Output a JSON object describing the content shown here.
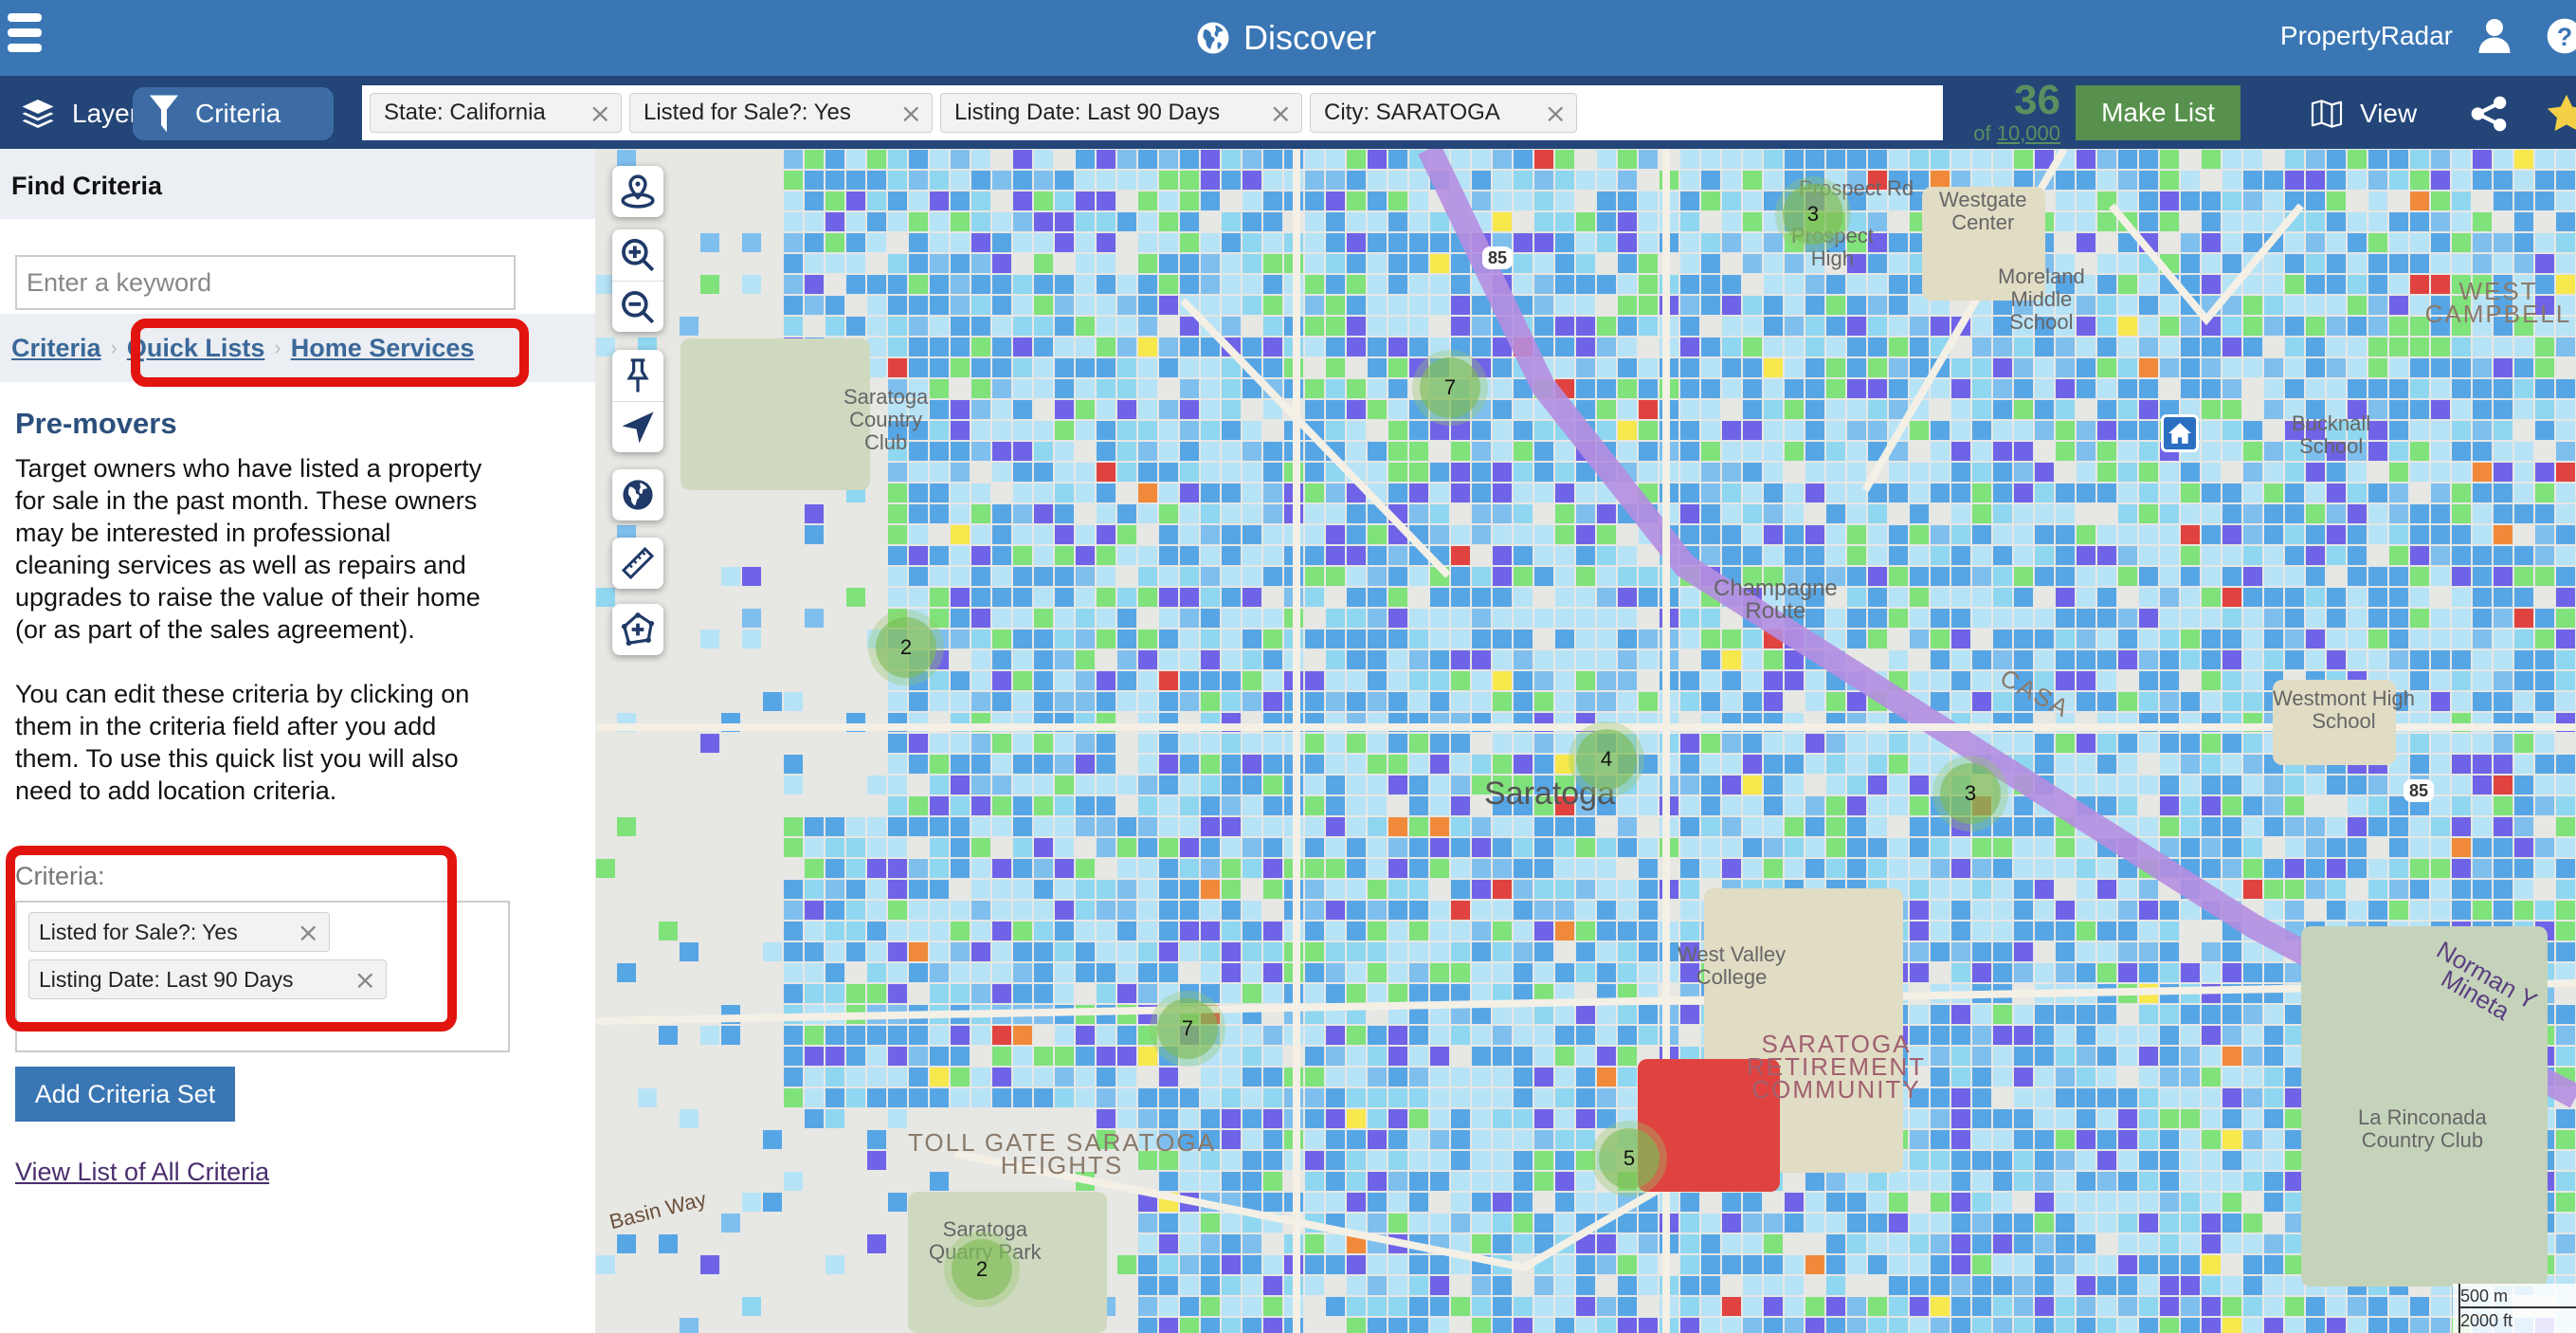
{
  "header": {
    "title": "Discover",
    "brand": "PropertyRadar",
    "icons": {
      "menu": "hamburger-icon",
      "title": "globe-icon",
      "user": "user-icon",
      "help": "help-icon"
    }
  },
  "toolbar": {
    "tabs": [
      {
        "label": "Layers",
        "icon": "layers-icon",
        "active": false
      },
      {
        "label": "Criteria",
        "icon": "filter-icon",
        "active": true
      }
    ],
    "filter_chips": [
      {
        "label": "State: California"
      },
      {
        "label": "Listed for Sale?: Yes"
      },
      {
        "label": "Listing Date: Last 90 Days"
      },
      {
        "label": "City: SARATOGA"
      }
    ],
    "chip_remove_glyph": "×",
    "result_count": "36",
    "result_of_prefix": "of ",
    "result_limit": "10,000",
    "make_list_label": "Make List",
    "view_label": "View",
    "share_icon": "share-icon",
    "star_icon": "star-icon",
    "colors": {
      "topbar": "#3a76b4",
      "toolbar": "#234578",
      "make_list": "#57914d",
      "count": "#5b8f5f"
    }
  },
  "sidebar": {
    "heading": "Find Criteria",
    "keyword_placeholder": "Enter a keyword",
    "keyword_value": "",
    "breadcrumb": [
      {
        "label": "Criteria"
      },
      {
        "label": "Quick Lists"
      },
      {
        "label": "Home Services"
      }
    ],
    "breadcrumb_separator": "›",
    "quick_list_title": "Pre-movers",
    "description_paragraphs": [
      "Target owners who have listed a property for sale in the past month. These owners may be interested in professional cleaning services as well as repairs and upgrades to raise the value of their home (or as part of the sales agreement).",
      "You can edit these criteria by clicking on them in the criteria field after you add them. To use this quick list you will also need to add location criteria."
    ],
    "criteria_label": "Criteria:",
    "criteria_chips": [
      {
        "label": "Listed for Sale?: Yes"
      },
      {
        "label": "Listing Date: Last 90 Days"
      }
    ],
    "add_set_label": "Add Criteria Set",
    "view_all_link": "View List of All Criteria",
    "annotation_color": "#e2140f"
  },
  "map": {
    "controls": [
      {
        "name": "locate-pin-icon",
        "title": "Location"
      },
      {
        "name": "zoom-in-icon",
        "title": "Zoom in"
      },
      {
        "name": "zoom-out-icon",
        "title": "Zoom out"
      },
      {
        "name": "pushpin-icon",
        "title": "Pin"
      },
      {
        "name": "navigate-arrow-icon",
        "title": "Navigate"
      },
      {
        "name": "globe-icon",
        "title": "Map type"
      },
      {
        "name": "ruler-icon",
        "title": "Measure"
      },
      {
        "name": "draw-shape-icon",
        "title": "Draw area"
      }
    ],
    "clusters": [
      "3",
      "7",
      "2",
      "4",
      "3",
      "7",
      "5",
      "2"
    ],
    "labels": {
      "saratoga_cc": "Saratoga\nCountry\nClub",
      "city": "Saratoga",
      "west_valley": "West Valley\nCollege",
      "westmont": "Westmont High\nSchool",
      "westgate": "Westgate\nCenter",
      "moreland": "Moreland\nMiddle\nSchool",
      "prospect_high": "Prospect\nHigh",
      "prospect_rd": "Prospect Rd",
      "champagne": "Champagne\nRoute",
      "casa": "CASA",
      "norman": "Norman Y Mineta",
      "quarry": "Saratoga\nQuarry Park",
      "toll_gate": "TOLL GATE SARATOGA\nHEIGHTS",
      "retirement": "SARATOGA\nRETIREMENT\nCOMMUNITY",
      "rinconada": "La Rinconada\nCountry Club",
      "basin_way": "Basin Way",
      "buckna": "Bucknall\nSchool",
      "west_camp": "WEST CAMPBELL",
      "highway": "85"
    },
    "scale": {
      "metric": "500 m",
      "imperial": "2000 ft"
    }
  }
}
